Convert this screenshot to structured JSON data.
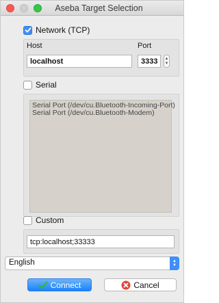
{
  "window": {
    "title": "Aseba Target Selection"
  },
  "network": {
    "label": "Network (TCP)",
    "checked": true,
    "host_label": "Host",
    "port_label": "Port",
    "host_value": "localhost",
    "port_value": "33333"
  },
  "serial": {
    "label": "Serial",
    "checked": false,
    "ports": [
      "Serial Port (/dev/cu.Bluetooth-Incoming-Port)",
      "Serial Port (/dev/cu.Bluetooth-Modem)"
    ]
  },
  "custom": {
    "label": "Custom",
    "checked": false,
    "target_value": "tcp:localhost;33333"
  },
  "language": {
    "selected": "English"
  },
  "buttons": {
    "connect_label": "Connect",
    "cancel_label": "Cancel"
  },
  "colors": {
    "accent": "#3f8ff7",
    "close": "#fc5753",
    "maximize": "#34c84a",
    "connect_check": "#2fb83a",
    "cancel_icon": "#e2453b"
  }
}
